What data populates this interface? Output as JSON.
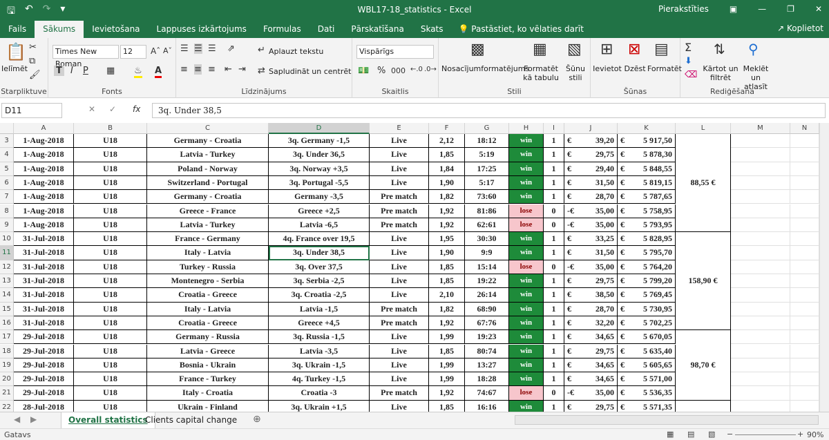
{
  "window": {
    "title": "WBL17-18_statistics  -  Excel",
    "signin": "Pierakstīties"
  },
  "ribbon_tabs": [
    "Fails",
    "Sākums",
    "Ievietošana",
    "Lappuses izkārtojums",
    "Formulas",
    "Dati",
    "Pārskatīšana",
    "Skats"
  ],
  "tell_me": "Pastāstiet, ko vēlaties darīt",
  "share": "Koplietot",
  "clipboard": {
    "paste": "Ielīmēt",
    "label": "Starpliktuve"
  },
  "font": {
    "name": "Times New Roman",
    "size": "12",
    "label": "Fonts",
    "bold": "T",
    "italic": "I",
    "underline": "P"
  },
  "alignment": {
    "wrap": "Aplauzt tekstu",
    "merge": "Sapludināt un centrēt",
    "label": "Līdzinājums"
  },
  "number": {
    "format": "Vispārīgs",
    "percent": "%",
    "comma": "000",
    "label": "Skaitlis"
  },
  "styles": {
    "conditional": "Nosacījumformatējums",
    "as_table": "Formatēt kā tabulu",
    "cell_styles": "Šūnu stili",
    "label": "Stili"
  },
  "cells": {
    "insert": "Ievietot",
    "delete": "Dzēst",
    "format": "Formatēt",
    "label": "Šūnas"
  },
  "editing": {
    "sort": "Kārtot un filtrēt",
    "find": "Meklēt un atlasīt",
    "label": "Rediģēšana"
  },
  "formula_bar": {
    "name_box": "D11",
    "content": "3q. Under 38,5"
  },
  "columns": [
    "A",
    "B",
    "C",
    "D",
    "E",
    "F",
    "G",
    "H",
    "I",
    "J",
    "K",
    "L",
    "M",
    "N"
  ],
  "rows": [
    {
      "n": "3",
      "a": "1-Aug-2018",
      "b": "U18",
      "c": "Germany - Croatia",
      "d": "3q. Germany -1,5",
      "e": "Live",
      "f": "2,12",
      "g": "18:12",
      "h": "win",
      "i": "1",
      "cs": "€",
      "j": "39,20",
      "ks": "€",
      "k": "5 917,50"
    },
    {
      "n": "4",
      "a": "1-Aug-2018",
      "b": "U18",
      "c": "Latvia - Turkey",
      "d": "3q. Under 36,5",
      "e": "Live",
      "f": "1,85",
      "g": "5:19",
      "h": "win",
      "i": "1",
      "cs": "€",
      "j": "29,75",
      "ks": "€",
      "k": "5 878,30"
    },
    {
      "n": "5",
      "a": "1-Aug-2018",
      "b": "U18",
      "c": "Poland - Norway",
      "d": "3q. Norway +3,5",
      "e": "Live",
      "f": "1,84",
      "g": "17:25",
      "h": "win",
      "i": "1",
      "cs": "€",
      "j": "29,40",
      "ks": "€",
      "k": "5 848,55"
    },
    {
      "n": "6",
      "a": "1-Aug-2018",
      "b": "U18",
      "c": "Switzerland - Portugal",
      "d": "3q. Portugal  -5,5",
      "e": "Live",
      "f": "1,90",
      "g": "5:17",
      "h": "win",
      "i": "1",
      "cs": "€",
      "j": "31,50",
      "ks": "€",
      "k": "5 819,15"
    },
    {
      "n": "7",
      "a": "1-Aug-2018",
      "b": "U18",
      "c": "Germany - Croatia",
      "d": "Germany -3,5",
      "e": "Pre match",
      "f": "1,82",
      "g": "73:60",
      "h": "win",
      "i": "1",
      "cs": "€",
      "j": "28,70",
      "ks": "€",
      "k": "5 787,65"
    },
    {
      "n": "8",
      "a": "1-Aug-2018",
      "b": "U18",
      "c": "Greece - France",
      "d": "Greece +2,5",
      "e": "Pre match",
      "f": "1,92",
      "g": "81:86",
      "h": "lose",
      "i": "0",
      "cs": "-€",
      "j": "35,00",
      "ks": "€",
      "k": "5 758,95"
    },
    {
      "n": "9",
      "a": "1-Aug-2018",
      "b": "U18",
      "c": "Latvia - Turkey",
      "d": "Latvia -6,5",
      "e": "Pre match",
      "f": "1,92",
      "g": "62:61",
      "h": "lose",
      "i": "0",
      "cs": "-€",
      "j": "35,00",
      "ks": "€",
      "k": "5 793,95"
    },
    {
      "n": "10",
      "a": "31-Jul-2018",
      "b": "U18",
      "c": "France - Germany",
      "d": "4q. France over 19,5",
      "e": "Live",
      "f": "1,95",
      "g": "30:30",
      "h": "win",
      "i": "1",
      "cs": "€",
      "j": "33,25",
      "ks": "€",
      "k": "5 828,95"
    },
    {
      "n": "11",
      "a": "31-Jul-2018",
      "b": "U18",
      "c": "Italy - Latvia",
      "d": "3q. Under 38,5",
      "e": "Live",
      "f": "1,90",
      "g": "9:9",
      "h": "win",
      "i": "1",
      "cs": "€",
      "j": "31,50",
      "ks": "€",
      "k": "5 795,70"
    },
    {
      "n": "12",
      "a": "31-Jul-2018",
      "b": "U18",
      "c": "Turkey - Russia",
      "d": "3q. Over 37,5",
      "e": "Live",
      "f": "1,85",
      "g": "15:14",
      "h": "lose",
      "i": "0",
      "cs": "-€",
      "j": "35,00",
      "ks": "€",
      "k": "5 764,20"
    },
    {
      "n": "13",
      "a": "31-Jul-2018",
      "b": "U18",
      "c": "Montenegro - Serbia",
      "d": "3q. Serbia -2,5",
      "e": "Live",
      "f": "1,85",
      "g": "19:22",
      "h": "win",
      "i": "1",
      "cs": "€",
      "j": "29,75",
      "ks": "€",
      "k": "5 799,20"
    },
    {
      "n": "14",
      "a": "31-Jul-2018",
      "b": "U18",
      "c": "Croatia - Greece",
      "d": "3q. Croatia -2,5",
      "e": "Live",
      "f": "2,10",
      "g": "26:14",
      "h": "win",
      "i": "1",
      "cs": "€",
      "j": "38,50",
      "ks": "€",
      "k": "5 769,45"
    },
    {
      "n": "15",
      "a": "31-Jul-2018",
      "b": "U18",
      "c": "Italy - Latvia",
      "d": "Latvia -1,5",
      "e": "Pre match",
      "f": "1,82",
      "g": "68:90",
      "h": "win",
      "i": "1",
      "cs": "€",
      "j": "28,70",
      "ks": "€",
      "k": "5 730,95"
    },
    {
      "n": "16",
      "a": "31-Jul-2018",
      "b": "U18",
      "c": "Croatia - Greece",
      "d": "Greece +4,5",
      "e": "Pre match",
      "f": "1,92",
      "g": "67:76",
      "h": "win",
      "i": "1",
      "cs": "€",
      "j": "32,20",
      "ks": "€",
      "k": "5 702,25"
    },
    {
      "n": "17",
      "a": "29-Jul-2018",
      "b": "U18",
      "c": "Germany - Russia",
      "d": "3q. Russia -1,5",
      "e": "Live",
      "f": "1,99",
      "g": "19:23",
      "h": "win",
      "i": "1",
      "cs": "€",
      "j": "34,65",
      "ks": "€",
      "k": "5 670,05"
    },
    {
      "n": "18",
      "a": "29-Jul-2018",
      "b": "U18",
      "c": "Latvia - Greece",
      "d": "Latvia -3,5",
      "e": "Live",
      "f": "1,85",
      "g": "80:74",
      "h": "win",
      "i": "1",
      "cs": "€",
      "j": "29,75",
      "ks": "€",
      "k": "5 635,40"
    },
    {
      "n": "19",
      "a": "29-Jul-2018",
      "b": "U18",
      "c": "Bosnia - Ukrain",
      "d": "3q. Ukrain -1,5",
      "e": "Live",
      "f": "1,99",
      "g": "13:27",
      "h": "win",
      "i": "1",
      "cs": "€",
      "j": "34,65",
      "ks": "€",
      "k": "5 605,65"
    },
    {
      "n": "20",
      "a": "29-Jul-2018",
      "b": "U18",
      "c": "France - Turkey",
      "d": "4q. Turkey -1,5",
      "e": "Live",
      "f": "1,99",
      "g": "18:28",
      "h": "win",
      "i": "1",
      "cs": "€",
      "j": "34,65",
      "ks": "€",
      "k": "5 571,00"
    },
    {
      "n": "21",
      "a": "29-Jul-2018",
      "b": "U18",
      "c": "Italy - Croatia",
      "d": "Croatia -3",
      "e": "Pre match",
      "f": "1,92",
      "g": "74:67",
      "h": "lose",
      "i": "0",
      "cs": "-€",
      "j": "35,00",
      "ks": "€",
      "k": "5 536,35"
    },
    {
      "n": "22",
      "a": "28-Jul-2018",
      "b": "U18",
      "c": "Ukrain - Finland",
      "d": "3q. Ukrain +1,5",
      "e": "Live",
      "f": "1,85",
      "g": "16:16",
      "h": "win",
      "i": "1",
      "cs": "€",
      "j": "29,75",
      "ks": "€",
      "k": "5 571,35"
    }
  ],
  "daily_totals": [
    "88,55 €",
    "158,90 €",
    "98,70 €"
  ],
  "sheet_tabs": [
    "Overall statistics",
    "Clients capital change"
  ],
  "status": {
    "mode": "Gatavs",
    "zoom": "90%"
  }
}
